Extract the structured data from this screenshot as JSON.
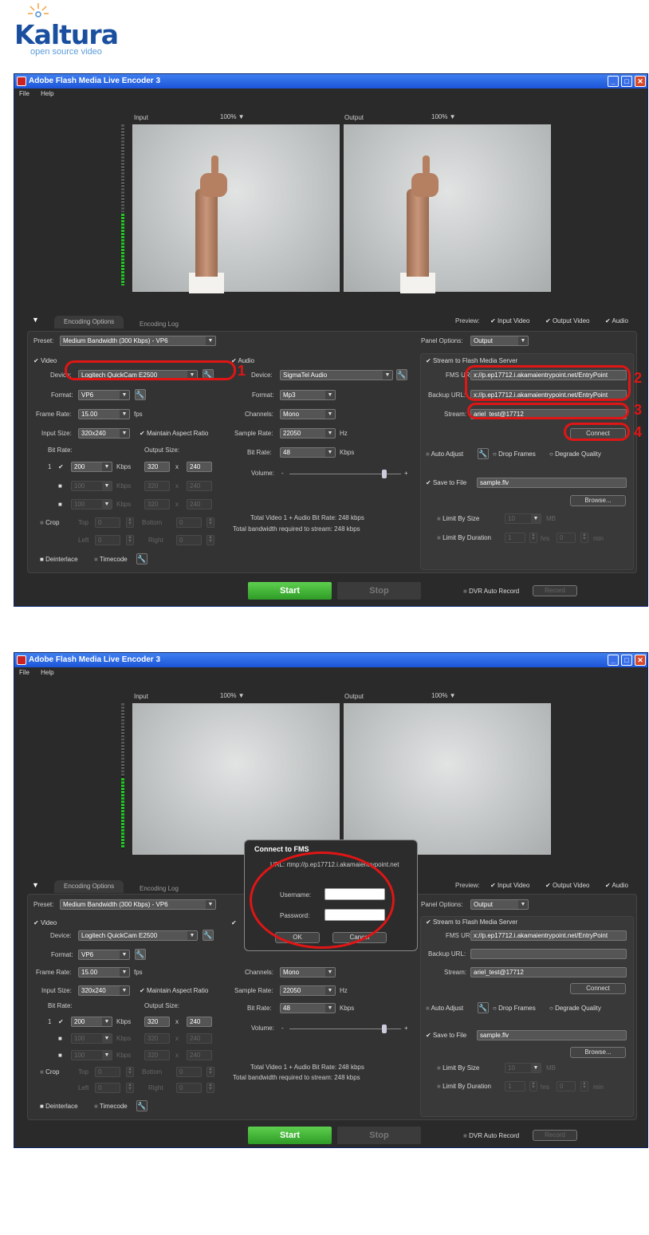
{
  "logo": {
    "word": "Kaltura",
    "tagline": "open source video"
  },
  "window": {
    "title": "Adobe Flash Media Live Encoder 3",
    "menu": [
      "File",
      "Help"
    ],
    "input_label": "Input",
    "output_label": "Output",
    "zoom_in": "100% ▼",
    "zoom_out": "100% ▼",
    "tabs": [
      "Encoding Options",
      "Encoding Log"
    ],
    "preview_label": "Preview:",
    "preview_items": [
      "Input Video",
      "Output Video",
      "Audio"
    ],
    "preset_label": "Preset:",
    "preset_value": "Medium Bandwidth (300 Kbps) - VP6",
    "panel_options_label": "Panel Options:",
    "panel_options_value": "Output",
    "video": {
      "header": "Video",
      "device_label": "Device:",
      "device_value": "Logitech QuickCam E2500",
      "format_label": "Format:",
      "format_value": "VP6",
      "frame_rate_label": "Frame Rate:",
      "frame_rate_value": "15.00",
      "fps": "fps",
      "input_size_label": "Input Size:",
      "input_size_value": "320x240",
      "maintain_aspect": "Maintain Aspect Ratio",
      "bit_rate_label": "Bit Rate:",
      "output_size_label": "Output Size:",
      "rows": [
        {
          "idx": "1",
          "rate": "200",
          "unit": "Kbps",
          "w": "320",
          "x": "x",
          "h": "240"
        },
        {
          "idx": "",
          "rate": "100",
          "unit": "Kbps",
          "w": "320",
          "x": "x",
          "h": "240"
        },
        {
          "idx": "",
          "rate": "100",
          "unit": "Kbps",
          "w": "320",
          "x": "x",
          "h": "240"
        }
      ],
      "crop": "Crop",
      "top": "Top",
      "bottom": "Bottom",
      "left": "Left",
      "right": "Right",
      "crop_value": "0",
      "deinterlace": "Deinterlace",
      "timecode": "Timecode"
    },
    "audio": {
      "header": "Audio",
      "device_label": "Device:",
      "device_value": "SigmaTel Audio",
      "format_label": "Format:",
      "format_value": "Mp3",
      "channels_label": "Channels:",
      "channels_value": "Mono",
      "sample_rate_label": "Sample Rate:",
      "sample_rate_value": "22050",
      "hz": "Hz",
      "bit_rate_label": "Bit Rate:",
      "bit_rate_value": "48",
      "kbps": "Kbps",
      "volume_label": "Volume:",
      "volume_minus": "-",
      "volume_plus": "+",
      "volume_level": 0.85,
      "total_line1": "Total Video 1 + Audio Bit Rate:  248 kbps",
      "total_line2": "Total bandwidth required to stream:  248 kbps"
    },
    "fms": {
      "header": "Stream to Flash Media Server",
      "fms_url_label": "FMS URL:",
      "fms_url_value": "x://p.ep17712.i.akamaientrypoint.net/EntryPoint",
      "backup_url_label": "Backup URL:",
      "backup_url_value": "x://p.ep17712.i.akamaientrypoint.net/EntryPoint",
      "stream_label": "Stream:",
      "stream_value": "ariel_test@17712",
      "connect": "Connect",
      "auto_adjust": "Auto Adjust",
      "drop_frames": "Drop Frames",
      "degrade_quality": "Degrade Quality",
      "save_to_file": "Save to File",
      "file_value": "sample.flv",
      "browse": "Browse...",
      "limit_size": "Limit By Size",
      "limit_size_value": "10",
      "mb": "MB",
      "limit_duration": "Limit By Duration",
      "dur_h": "1",
      "hrs": "hrs",
      "dur_m": "0",
      "min": "min"
    },
    "start": "Start",
    "stop": "Stop",
    "dvr": "DVR Auto Record",
    "record": "Record"
  },
  "annotations": [
    "1",
    "2",
    "3",
    "4"
  ],
  "dialog": {
    "title": "Connect to FMS",
    "url": "URL: rtmp://p.ep17712.i.akamaientrypoint.net",
    "username_label": "Username:",
    "password_label": "Password:",
    "ok": "OK",
    "cancel": "Cancel"
  }
}
